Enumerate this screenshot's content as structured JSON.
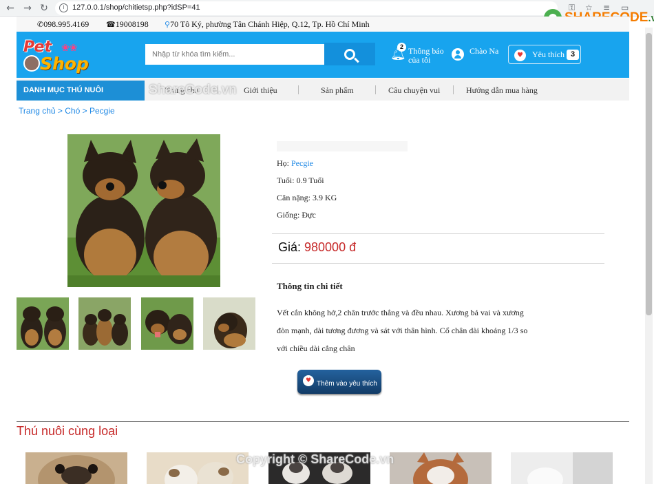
{
  "browser": {
    "back": "←",
    "forward": "→",
    "reload": "↻",
    "url": "127.0.0.1/shop/chitietsp.php?idSP=41",
    "icons": [
      "key-icon",
      "star-icon",
      "playlist-icon",
      "cast-icon"
    ]
  },
  "watermark_logo": {
    "text": "SHARECODE",
    "suffix": ".vn"
  },
  "topbar": {
    "phone": "098.995.4169",
    "hotline": "19008198",
    "address": "70 Tô Ký, phường Tân Chánh Hiệp, Q.12, Tp. Hồ Chí Minh"
  },
  "header": {
    "logo_top": "Pet",
    "logo_bottom": "Shop",
    "search_placeholder": "Nhập từ khóa tìm kiếm...",
    "notify_count": "2",
    "notify_label": "Thông báo của tôi",
    "user_label": "Chào Na",
    "wishlist_label": "Yêu thích",
    "wishlist_count": "3"
  },
  "menu": {
    "category": "DANH MỤC THÚ NUÔI",
    "items": [
      "Trang chủ",
      "Giới thiệu",
      "Sản phẩm",
      "Câu chuyện vui",
      "Hướng dẫn mua hàng"
    ]
  },
  "breadcrumb": "Trang chủ > Chó > Pecgie",
  "product": {
    "family_label": "Họ: ",
    "family_value": "Pecgie",
    "age": "Tuổi: 0.9 Tuổi",
    "weight": "Cân nặng: 3.9 KG",
    "gender": "Giống: Đực",
    "price_label": "Giá: ",
    "price_value": "980000 đ",
    "detail_title": "Thông tin chi tiết",
    "detail_text": "Vết cắn không hở,2 chân trước thẳng và đều nhau. Xương bả vai và xương đòn mạnh, dài tương đương và sát với thân hình. Cổ chân dài khoảng 1/3 so với chiều dài cẳng chân",
    "add_button": "Thêm vào yêu thích"
  },
  "related": {
    "title": "Thú nuôi cùng loại"
  },
  "watermarks": {
    "center": "ShareCode.vn",
    "footer": "Copyright © ShareCode.vn"
  }
}
